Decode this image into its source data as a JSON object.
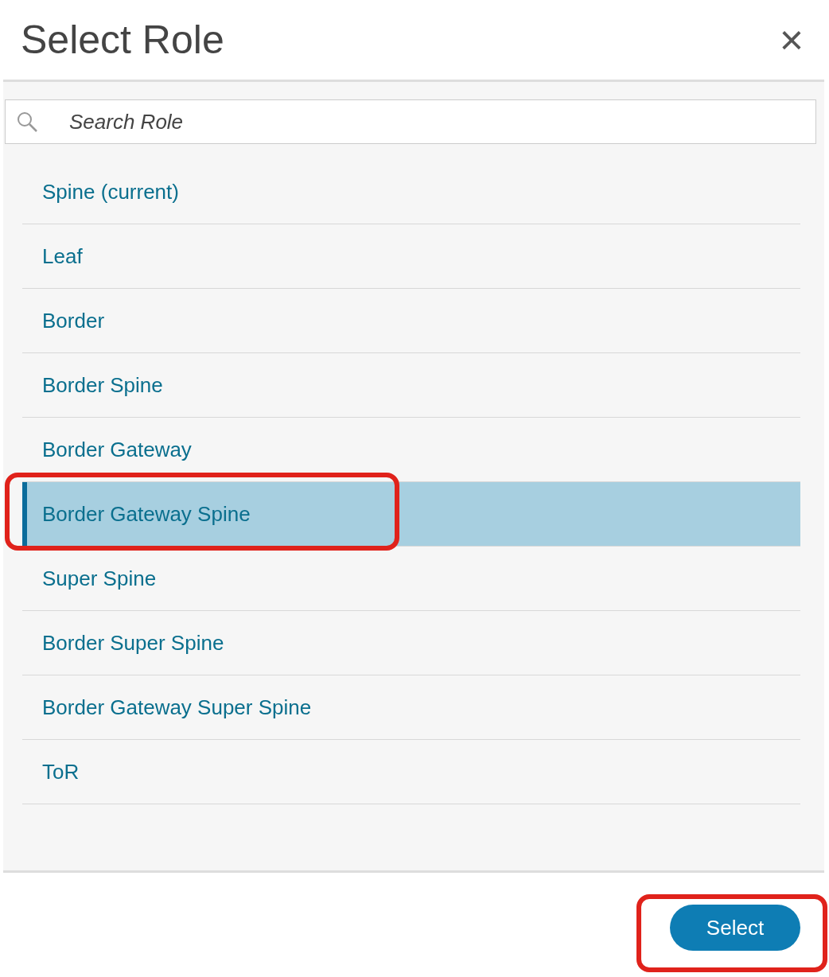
{
  "dialog": {
    "title": "Select Role",
    "close": "×"
  },
  "search": {
    "placeholder": "Search Role"
  },
  "roles": [
    {
      "label": "Spine (current)",
      "selected": false,
      "highlighted": false
    },
    {
      "label": "Leaf",
      "selected": false,
      "highlighted": false
    },
    {
      "label": "Border",
      "selected": false,
      "highlighted": false
    },
    {
      "label": "Border Spine",
      "selected": false,
      "highlighted": false
    },
    {
      "label": "Border Gateway",
      "selected": false,
      "highlighted": false
    },
    {
      "label": "Border Gateway Spine",
      "selected": true,
      "highlighted": true
    },
    {
      "label": "Super Spine",
      "selected": false,
      "highlighted": false
    },
    {
      "label": "Border Super Spine",
      "selected": false,
      "highlighted": false
    },
    {
      "label": "Border Gateway Super Spine",
      "selected": false,
      "highlighted": false
    },
    {
      "label": "ToR",
      "selected": false,
      "highlighted": false
    }
  ],
  "footer": {
    "button": "Select",
    "highlighted": true
  }
}
